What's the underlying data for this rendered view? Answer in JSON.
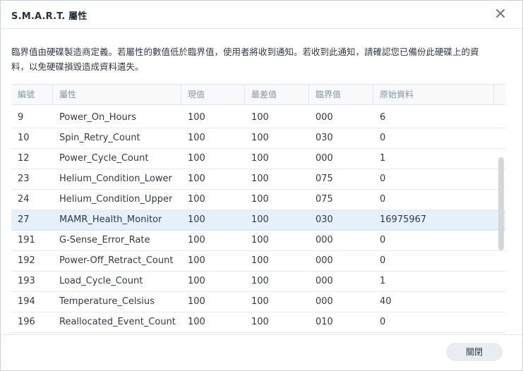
{
  "dialog": {
    "title": "S.M.A.R.T. 屬性",
    "description_line1": "臨界值由硬碟製造商定義。若屬性的數值低於臨界值，使用者將收到通知。若收到此通知，請確認您已備份此硬碟上的資",
    "description_line2": "料，以免硬碟損毀造成資料遺失。",
    "close_button_label": "關閉",
    "close_icon": "close-icon"
  },
  "table": {
    "columns": [
      "編號",
      "屬性",
      "現值",
      "最差值",
      "臨界值",
      "原始資料"
    ],
    "rows": [
      {
        "id": "9",
        "attribute": "Power_On_Hours",
        "current": "100",
        "worst": "100",
        "threshold": "000",
        "raw": "6"
      },
      {
        "id": "10",
        "attribute": "Spin_Retry_Count",
        "current": "100",
        "worst": "100",
        "threshold": "030",
        "raw": "0"
      },
      {
        "id": "12",
        "attribute": "Power_Cycle_Count",
        "current": "100",
        "worst": "100",
        "threshold": "000",
        "raw": "1"
      },
      {
        "id": "23",
        "attribute": "Helium_Condition_Lower",
        "current": "100",
        "worst": "100",
        "threshold": "075",
        "raw": "0"
      },
      {
        "id": "24",
        "attribute": "Helium_Condition_Upper",
        "current": "100",
        "worst": "100",
        "threshold": "075",
        "raw": "0"
      },
      {
        "id": "27",
        "attribute": "MAMR_Health_Monitor",
        "current": "100",
        "worst": "100",
        "threshold": "030",
        "raw": "16975967"
      },
      {
        "id": "191",
        "attribute": "G-Sense_Error_Rate",
        "current": "100",
        "worst": "100",
        "threshold": "000",
        "raw": "0"
      },
      {
        "id": "192",
        "attribute": "Power-Off_Retract_Count",
        "current": "100",
        "worst": "100",
        "threshold": "000",
        "raw": "0"
      },
      {
        "id": "193",
        "attribute": "Load_Cycle_Count",
        "current": "100",
        "worst": "100",
        "threshold": "000",
        "raw": "1"
      },
      {
        "id": "194",
        "attribute": "Temperature_Celsius",
        "current": "100",
        "worst": "100",
        "threshold": "000",
        "raw": "40"
      },
      {
        "id": "196",
        "attribute": "Reallocated_Event_Count",
        "current": "100",
        "worst": "100",
        "threshold": "010",
        "raw": "0"
      }
    ],
    "selected_row_id": "27"
  }
}
